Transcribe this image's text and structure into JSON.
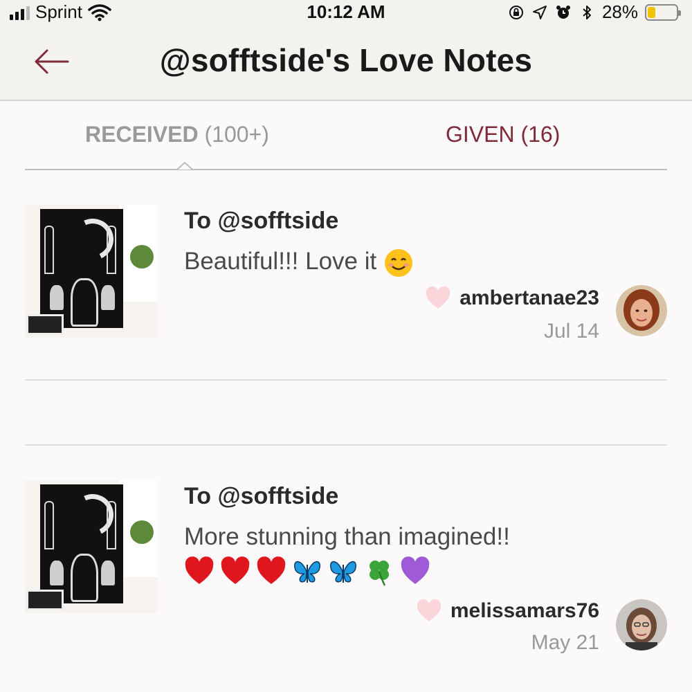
{
  "status_bar": {
    "carrier": "Sprint",
    "time": "10:12 AM",
    "battery_percent_label": "28%",
    "battery_level": 0.28,
    "battery_color": "#f0c400"
  },
  "header": {
    "title": "@sofftside's Love Notes",
    "back_icon": "arrow-left-icon",
    "accent_color": "#7e2a38"
  },
  "tabs": {
    "received_label": "RECEIVED",
    "received_count": "(100+)",
    "given_label": "GIVEN (16)"
  },
  "notes": [
    {
      "to": "To @sofftside",
      "message": "Beautiful!!! Love it",
      "emojis": [
        "smiling-face-icon"
      ],
      "giver": "ambertanae23",
      "date": "Jul 14"
    },
    {
      "to": "To @sofftside",
      "message": "More stunning than imagined!!",
      "emojis": [
        "red-heart-icon",
        "red-heart-icon",
        "red-heart-icon",
        "butterfly-icon",
        "butterfly-icon",
        "four-leaf-clover-icon",
        "purple-heart-icon"
      ],
      "giver": "melissamars76",
      "date": "May 21"
    }
  ]
}
